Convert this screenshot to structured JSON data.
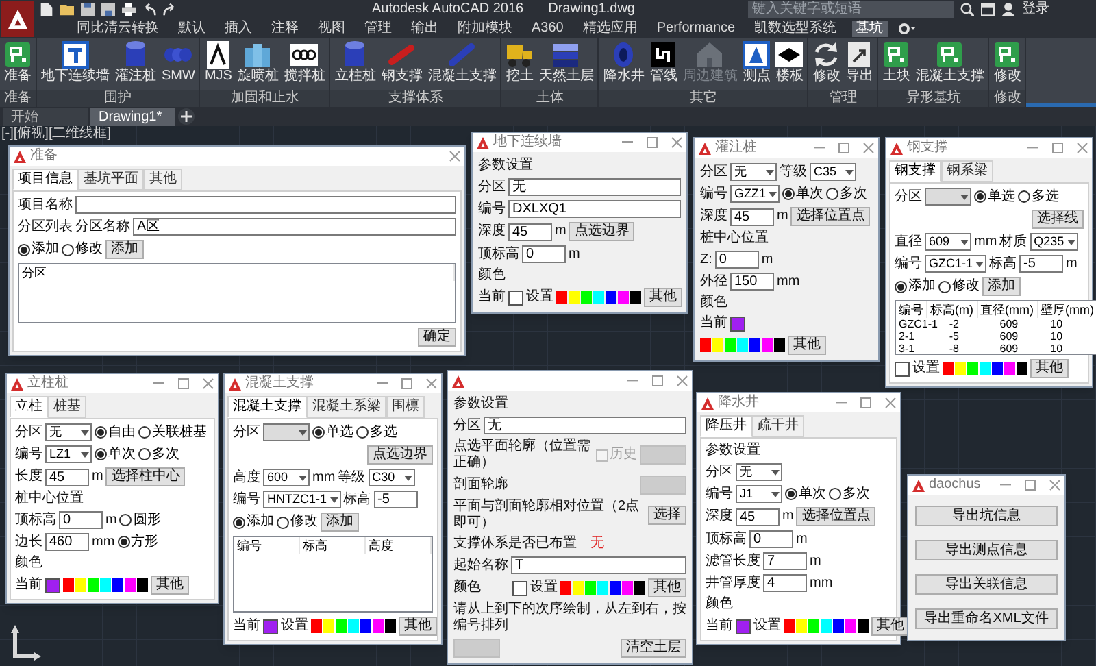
{
  "app": {
    "title": "Autodesk AutoCAD 2016",
    "document": "Drawing1.dwg",
    "search": {
      "placeholder": "键入关键字或短语"
    },
    "sign_in": "登录"
  },
  "menu_tabs": [
    {
      "label": "同比清云转换",
      "selected": false
    },
    {
      "label": "默认",
      "selected": false
    },
    {
      "label": "插入",
      "selected": false
    },
    {
      "label": "注释",
      "selected": false
    },
    {
      "label": "视图",
      "selected": false
    },
    {
      "label": "管理",
      "selected": false
    },
    {
      "label": "输出",
      "selected": false
    },
    {
      "label": "附加模块",
      "selected": false
    },
    {
      "label": "A360",
      "selected": false
    },
    {
      "label": "精选应用",
      "selected": false
    },
    {
      "label": "Performance",
      "selected": false
    },
    {
      "label": "凯数选型系统",
      "selected": false
    },
    {
      "label": "基坑",
      "selected": true
    }
  ],
  "ribbon": [
    {
      "label": "准备",
      "buttons": [
        {
          "label": "准备",
          "disabled": false
        }
      ]
    },
    {
      "label": "围护",
      "buttons": [
        {
          "label": "地下连续墙",
          "disabled": false
        },
        {
          "label": "灌注桩",
          "disabled": false
        },
        {
          "label": "SMW",
          "disabled": false
        }
      ]
    },
    {
      "label": "加固和止水",
      "buttons": [
        {
          "label": "MJS",
          "disabled": false
        },
        {
          "label": "旋喷桩",
          "disabled": false
        },
        {
          "label": "搅拌桩",
          "disabled": false
        }
      ]
    },
    {
      "label": "支撑体系",
      "buttons": [
        {
          "label": "立柱桩",
          "disabled": false
        },
        {
          "label": "钢支撑",
          "disabled": false
        },
        {
          "label": "混凝土支撑",
          "disabled": false
        }
      ]
    },
    {
      "label": "土体",
      "buttons": [
        {
          "label": "挖土",
          "disabled": false
        },
        {
          "label": "天然土层",
          "disabled": false
        }
      ]
    },
    {
      "label": "其它",
      "buttons": [
        {
          "label": "降水井",
          "disabled": false
        },
        {
          "label": "管线",
          "disabled": false
        },
        {
          "label": "周边建筑",
          "disabled": true
        },
        {
          "label": "测点",
          "disabled": false
        },
        {
          "label": "楼板",
          "disabled": false
        }
      ]
    },
    {
      "label": "管理",
      "buttons": [
        {
          "label": "修改",
          "disabled": false
        },
        {
          "label": "导出",
          "disabled": false
        }
      ]
    },
    {
      "label": "异形基坑",
      "buttons": [
        {
          "label": "土块",
          "disabled": false
        },
        {
          "label": "混凝土支撑",
          "disabled": false
        }
      ]
    },
    {
      "label": "修改",
      "buttons": [
        {
          "label": "修改",
          "disabled": false
        }
      ]
    }
  ],
  "doc_tabs": [
    {
      "label": "开始",
      "selected": false
    },
    {
      "label": "Drawing1*",
      "selected": true
    }
  ],
  "viewport_label": "[-][俯视][二维线框]",
  "windows": [
    {
      "title": "准备",
      "min_max": false,
      "tabs": [
        {
          "label": "项目信息",
          "selected": true
        },
        {
          "label": "基坑平面",
          "selected": false
        },
        {
          "label": "其他",
          "selected": false
        }
      ],
      "lines": [
        {
          "items": [
            {
              "kind": "label",
              "text": "项目名称"
            },
            {
              "kind": "field"
            }
          ]
        },
        {
          "items": [
            {
              "kind": "label",
              "text": "分区列表"
            },
            {
              "kind": "label",
              "text": "分区名称"
            },
            {
              "kind": "field",
              "value": "A区"
            }
          ]
        },
        {
          "items": [
            {
              "kind": "radio",
              "label": "添加",
              "selected": true
            },
            {
              "kind": "radio",
              "label": "修改",
              "selected": false
            },
            {
              "kind": "button",
              "label": "添加",
              "disabled": false
            }
          ]
        },
        {
          "items": [
            {
              "kind": "list",
              "columns": [
                "分区"
              ]
            }
          ]
        },
        {
          "items": [
            {
              "kind": "button",
              "label": "确定",
              "disabled": false
            }
          ]
        }
      ]
    },
    {
      "title": "地下连续墙",
      "min_max": true,
      "lines": [
        {
          "items": [
            {
              "kind": "label",
              "text": "参数设置"
            }
          ]
        },
        {
          "items": [
            {
              "kind": "label",
              "text": "分区"
            },
            {
              "kind": "field",
              "value": "无"
            }
          ]
        },
        {
          "items": [
            {
              "kind": "label",
              "text": "编号"
            },
            {
              "kind": "field",
              "value": "DXLXQ1"
            }
          ]
        },
        {
          "items": [
            {
              "kind": "label",
              "text": "深度"
            },
            {
              "kind": "input",
              "value": "45"
            },
            {
              "kind": "label",
              "text": "m"
            },
            {
              "kind": "button",
              "label": "点选边界",
              "disabled": false
            }
          ]
        },
        {
          "items": [
            {
              "kind": "label",
              "text": "顶标高"
            },
            {
              "kind": "input",
              "value": "0"
            },
            {
              "kind": "label",
              "text": "m"
            }
          ]
        },
        {
          "items": [
            {
              "kind": "label",
              "text": "颜色"
            }
          ]
        },
        {
          "items": [
            {
              "kind": "label",
              "text": "当前"
            },
            {
              "kind": "swatch",
              "color": "#ffffff"
            },
            {
              "kind": "label",
              "text": "设置"
            },
            {
              "kind": "palette",
              "swatches": [
                {
                  "color": "#ff0000"
                },
                {
                  "color": "#ffff00"
                },
                {
                  "color": "#00ff00"
                },
                {
                  "color": "#00ffff"
                },
                {
                  "color": "#0000ff"
                },
                {
                  "color": "#ff00ff"
                },
                {
                  "color": "#000000"
                }
              ]
            },
            {
              "kind": "button",
              "label": "其他",
              "disabled": false
            }
          ]
        }
      ]
    },
    {
      "title": "灌注桩",
      "min_max": true,
      "lines": [
        {
          "items": [
            {
              "kind": "label",
              "text": "分区"
            },
            {
              "kind": "combo",
              "value": "无",
              "disabled": false
            },
            {
              "kind": "label",
              "text": "等级"
            },
            {
              "kind": "combo",
              "value": "C35",
              "disabled": false
            }
          ]
        },
        {
          "items": [
            {
              "kind": "label",
              "text": "编号"
            },
            {
              "kind": "combo",
              "value": "GZZ1",
              "disabled": false
            },
            {
              "kind": "radio",
              "label": "单次",
              "selected": true
            },
            {
              "kind": "radio",
              "label": "多次",
              "selected": false
            }
          ]
        },
        {
          "items": [
            {
              "kind": "label",
              "text": "深度"
            },
            {
              "kind": "input",
              "value": "45"
            },
            {
              "kind": "label",
              "text": "m"
            },
            {
              "kind": "button",
              "label": "选择位置点",
              "disabled": false
            }
          ]
        },
        {
          "items": [
            {
              "kind": "label",
              "text": "桩中心位置"
            }
          ]
        },
        {
          "items": [
            {
              "kind": "label",
              "text": "Z:"
            },
            {
              "kind": "input",
              "value": "0"
            },
            {
              "kind": "label",
              "text": "m"
            }
          ]
        },
        {
          "items": [
            {
              "kind": "label",
              "text": "外径"
            },
            {
              "kind": "input",
              "value": "150"
            },
            {
              "kind": "label",
              "text": "mm"
            }
          ]
        },
        {
          "items": [
            {
              "kind": "label",
              "text": "颜色"
            }
          ]
        },
        {
          "items": [
            {
              "kind": "label",
              "text": "当前"
            },
            {
              "kind": "swatch",
              "color": "#a020f0"
            }
          ]
        },
        {
          "items": [
            {
              "kind": "palette",
              "swatches": [
                {
                  "color": "#ff0000"
                },
                {
                  "color": "#ffff00"
                },
                {
                  "color": "#00ff00"
                },
                {
                  "color": "#00ffff"
                },
                {
                  "color": "#0000ff"
                },
                {
                  "color": "#ff00ff"
                },
                {
                  "color": "#000000"
                }
              ]
            },
            {
              "kind": "button",
              "label": "其他",
              "disabled": false
            }
          ]
        }
      ]
    },
    {
      "title": "钢支撑",
      "min_max": true,
      "tabs": [
        {
          "label": "钢支撑",
          "selected": true
        },
        {
          "label": "钢系梁",
          "selected": false
        }
      ],
      "lines": [
        {
          "items": [
            {
              "kind": "label",
              "text": "分区"
            },
            {
              "kind": "combo",
              "disabled": true
            },
            {
              "kind": "radio",
              "label": "单选",
              "selected": true
            },
            {
              "kind": "radio",
              "label": "多选",
              "selected": false
            }
          ]
        },
        {
          "items": [
            {
              "kind": "button",
              "label": "选择线",
              "disabled": false
            }
          ]
        },
        {
          "items": [
            {
              "kind": "label",
              "text": "直径"
            },
            {
              "kind": "combo",
              "value": "609",
              "disabled": false
            },
            {
              "kind": "label",
              "text": "mm"
            },
            {
              "kind": "label",
              "text": "材质"
            },
            {
              "kind": "combo",
              "value": "Q235",
              "disabled": false
            }
          ]
        },
        {
          "items": [
            {
              "kind": "label",
              "text": "编号"
            },
            {
              "kind": "combo",
              "value": "GZC1-1",
              "disabled": false
            },
            {
              "kind": "label",
              "text": "标高"
            },
            {
              "kind": "input",
              "value": "-5"
            },
            {
              "kind": "label",
              "text": "m"
            }
          ]
        },
        {
          "items": [
            {
              "kind": "radio",
              "label": "添加",
              "selected": true
            },
            {
              "kind": "radio",
              "label": "修改",
              "selected": false
            },
            {
              "kind": "button",
              "label": "添加",
              "disabled": false
            }
          ]
        },
        {
          "items": [
            {
              "kind": "list",
              "columns": [
                "编号",
                "标高(m)",
                "直径(mm)",
                "壁厚(mm)"
              ],
              "rows": [
                [
                  "GZC1-1",
                  "-2",
                  "609",
                  "10"
                ],
                [
                  "2-1",
                  "-5",
                  "609",
                  "10"
                ],
                [
                  "3-1",
                  "-8",
                  "609",
                  "10"
                ]
              ]
            }
          ]
        },
        {
          "items": [
            {
              "kind": "swatch",
              "color": "#ffffff"
            },
            {
              "kind": "label",
              "text": "设置"
            },
            {
              "kind": "palette",
              "swatches": [
                {
                  "color": "#ff0000"
                },
                {
                  "color": "#ffff00"
                },
                {
                  "color": "#00ff00"
                },
                {
                  "color": "#00ffff"
                },
                {
                  "color": "#0000ff"
                },
                {
                  "color": "#ff00ff"
                },
                {
                  "color": "#000000"
                }
              ]
            },
            {
              "kind": "button",
              "label": "其他",
              "disabled": false
            }
          ]
        }
      ]
    },
    {
      "title": "立柱桩",
      "min_max": true,
      "tabs": [
        {
          "label": "立柱",
          "selected": true
        },
        {
          "label": "桩基",
          "selected": false
        }
      ],
      "lines": [
        {
          "items": [
            {
              "kind": "label",
              "text": "分区"
            },
            {
              "kind": "combo",
              "value": "无",
              "disabled": false
            },
            {
              "kind": "radio",
              "label": "自由",
              "selected": true
            },
            {
              "kind": "radio",
              "label": "关联桩基",
              "selected": false
            }
          ]
        },
        {
          "items": [
            {
              "kind": "label",
              "text": "编号"
            },
            {
              "kind": "combo",
              "value": "LZ1",
              "disabled": false
            },
            {
              "kind": "radio",
              "label": "单次",
              "selected": true
            },
            {
              "kind": "radio",
              "label": "多次",
              "selected": false
            }
          ]
        },
        {
          "items": [
            {
              "kind": "label",
              "text": "长度"
            },
            {
              "kind": "input",
              "value": "45"
            },
            {
              "kind": "label",
              "text": "m"
            },
            {
              "kind": "button",
              "label": "选择柱中心",
              "disabled": false
            }
          ]
        },
        {
          "items": [
            {
              "kind": "label",
              "text": "桩中心位置"
            }
          ]
        },
        {
          "items": [
            {
              "kind": "label",
              "text": "顶标高"
            },
            {
              "kind": "input",
              "value": "0"
            },
            {
              "kind": "label",
              "text": "m"
            },
            {
              "kind": "radio",
              "label": "圆形",
              "selected": false
            }
          ]
        },
        {
          "items": [
            {
              "kind": "label",
              "text": "边长"
            },
            {
              "kind": "input",
              "value": "460"
            },
            {
              "kind": "label",
              "text": "mm"
            },
            {
              "kind": "radio",
              "label": "方形",
              "selected": true
            }
          ]
        },
        {
          "items": [
            {
              "kind": "label",
              "text": "颜色"
            }
          ]
        },
        {
          "items": [
            {
              "kind": "label",
              "text": "当前"
            },
            {
              "kind": "swatch",
              "color": "#a020f0"
            },
            {
              "kind": "palette",
              "swatches": [
                {
                  "color": "#ff0000"
                },
                {
                  "color": "#ffff00"
                },
                {
                  "color": "#00ff00"
                },
                {
                  "color": "#00ffff"
                },
                {
                  "color": "#0000ff"
                },
                {
                  "color": "#ff00ff"
                },
                {
                  "color": "#000000"
                }
              ]
            },
            {
              "kind": "button",
              "label": "其他",
              "disabled": false
            }
          ]
        }
      ]
    },
    {
      "title": "混凝土支撑",
      "min_max": true,
      "tabs": [
        {
          "label": "混凝土支撑",
          "selected": true
        },
        {
          "label": "混凝土系梁",
          "selected": false
        },
        {
          "label": "围檩",
          "selected": false
        }
      ],
      "lines": [
        {
          "items": [
            {
              "kind": "label",
              "text": "分区"
            },
            {
              "kind": "combo",
              "disabled": true
            },
            {
              "kind": "radio",
              "label": "单选",
              "selected": true
            },
            {
              "kind": "radio",
              "label": "多选",
              "selected": false
            }
          ]
        },
        {
          "items": [
            {
              "kind": "button",
              "label": "点选边界",
              "disabled": false
            }
          ]
        },
        {
          "items": [
            {
              "kind": "label",
              "text": "高度"
            },
            {
              "kind": "combo",
              "value": "600",
              "disabled": false
            },
            {
              "kind": "label",
              "text": "mm"
            },
            {
              "kind": "label",
              "text": "等级"
            },
            {
              "kind": "combo",
              "value": "C30",
              "disabled": false
            }
          ]
        },
        {
          "items": [
            {
              "kind": "label",
              "text": "编号"
            },
            {
              "kind": "combo",
              "value": "HNTZC1-1",
              "disabled": false
            },
            {
              "kind": "label",
              "text": "标高"
            },
            {
              "kind": "input",
              "value": "-5"
            }
          ]
        },
        {
          "items": [
            {
              "kind": "radio",
              "label": "添加",
              "selected": true
            },
            {
              "kind": "radio",
              "label": "修改",
              "selected": false
            },
            {
              "kind": "button",
              "label": "添加",
              "disabled": false
            }
          ]
        },
        {
          "items": [
            {
              "kind": "list",
              "columns": [
                "编号",
                "标高",
                "高度"
              ]
            }
          ]
        },
        {
          "items": [
            {
              "kind": "label",
              "text": "当前"
            },
            {
              "kind": "swatch",
              "color": "#a020f0"
            },
            {
              "kind": "label",
              "text": "设置"
            },
            {
              "kind": "palette",
              "swatches": [
                {
                  "color": "#ff0000"
                },
                {
                  "color": "#ffff00"
                },
                {
                  "color": "#00ff00"
                },
                {
                  "color": "#00ffff"
                },
                {
                  "color": "#0000ff"
                },
                {
                  "color": "#ff00ff"
                },
                {
                  "color": "#000000"
                }
              ]
            },
            {
              "kind": "button",
              "label": "其他",
              "disabled": false
            }
          ]
        }
      ]
    },
    {
      "min_max": true,
      "lines": [
        {
          "items": [
            {
              "kind": "label",
              "text": "参数设置"
            }
          ]
        },
        {
          "items": [
            {
              "kind": "label",
              "text": "分区"
            },
            {
              "kind": "field",
              "value": "无"
            }
          ]
        },
        {
          "items": [
            {
              "kind": "label",
              "text": "点选平面轮廓（位置需正确）"
            },
            {
              "kind": "checkbox",
              "label": "历史",
              "checked": false,
              "disabled": true
            },
            {
              "kind": "button",
              "disabled": true
            }
          ]
        },
        {
          "items": [
            {
              "kind": "label",
              "text": "剖面轮廓"
            },
            {
              "kind": "button",
              "disabled": true
            }
          ]
        },
        {
          "items": [
            {
              "kind": "label",
              "text": "平面与剖面轮廓相对位置（2点即可）"
            },
            {
              "kind": "button",
              "label": "选择",
              "disabled": false
            }
          ]
        },
        {
          "items": [
            {
              "kind": "label",
              "text": "支撑体系是否已布置"
            },
            {
              "kind": "note",
              "text": "无"
            }
          ]
        },
        {
          "items": [
            {
              "kind": "label",
              "text": "起始名称"
            },
            {
              "kind": "field",
              "value": "T"
            }
          ]
        },
        {
          "items": [
            {
              "kind": "label",
              "text": "颜色"
            },
            {
              "kind": "swatch",
              "color": "#ffffff"
            },
            {
              "kind": "label",
              "text": "设置"
            },
            {
              "kind": "palette",
              "swatches": [
                {
                  "color": "#ff0000"
                },
                {
                  "color": "#ffff00"
                },
                {
                  "color": "#00ff00"
                },
                {
                  "color": "#00ffff"
                },
                {
                  "color": "#0000ff"
                },
                {
                  "color": "#ff00ff"
                },
                {
                  "color": "#000000"
                }
              ]
            },
            {
              "kind": "button",
              "label": "其他",
              "disabled": false
            }
          ]
        },
        {
          "items": [
            {
              "kind": "label",
              "text": "请从上到下的次序绘制，从左到右，按编号排列"
            }
          ]
        },
        {
          "items": [
            {
              "kind": "button",
              "disabled": true
            },
            {
              "kind": "button",
              "label": "清空土层",
              "disabled": false
            }
          ]
        }
      ]
    },
    {
      "title": "降水井",
      "min_max": true,
      "tabs": [
        {
          "label": "降压井",
          "selected": true
        },
        {
          "label": "疏干井",
          "selected": false
        }
      ],
      "lines": [
        {
          "items": [
            {
              "kind": "label",
              "text": "参数设置"
            }
          ]
        },
        {
          "items": [
            {
              "kind": "label",
              "text": "分区"
            },
            {
              "kind": "combo",
              "value": "无",
              "disabled": false
            }
          ]
        },
        {
          "items": [
            {
              "kind": "label",
              "text": "编号"
            },
            {
              "kind": "combo",
              "value": "J1",
              "disabled": false
            },
            {
              "kind": "radio",
              "label": "单次",
              "selected": true
            },
            {
              "kind": "radio",
              "label": "多次",
              "selected": false
            }
          ]
        },
        {
          "items": [
            {
              "kind": "label",
              "text": "深度"
            },
            {
              "kind": "input",
              "value": "45"
            },
            {
              "kind": "label",
              "text": "m"
            },
            {
              "kind": "button",
              "label": "选择位置点",
              "disabled": false
            }
          ]
        },
        {
          "items": [
            {
              "kind": "label",
              "text": "顶标高"
            },
            {
              "kind": "input",
              "value": "0"
            },
            {
              "kind": "label",
              "text": "m"
            }
          ]
        },
        {
          "items": [
            {
              "kind": "label",
              "text": "滤管长度"
            },
            {
              "kind": "input",
              "value": "7"
            },
            {
              "kind": "label",
              "text": "m"
            }
          ]
        },
        {
          "items": [
            {
              "kind": "label",
              "text": "井管厚度"
            },
            {
              "kind": "input",
              "value": "4"
            },
            {
              "kind": "label",
              "text": "mm"
            }
          ]
        },
        {
          "items": [
            {
              "kind": "label",
              "text": "颜色"
            }
          ]
        },
        {
          "items": [
            {
              "kind": "label",
              "text": "当前"
            },
            {
              "kind": "swatch",
              "color": "#a020f0"
            },
            {
              "kind": "label",
              "text": "设置"
            },
            {
              "kind": "palette",
              "swatches": [
                {
                  "color": "#ff0000"
                },
                {
                  "color": "#ffff00"
                },
                {
                  "color": "#00ff00"
                },
                {
                  "color": "#00ffff"
                },
                {
                  "color": "#0000ff"
                },
                {
                  "color": "#ff00ff"
                },
                {
                  "color": "#000000"
                }
              ]
            },
            {
              "kind": "button",
              "label": "其他",
              "disabled": false
            }
          ]
        }
      ]
    },
    {
      "title": "daochus",
      "min_max": true,
      "lines": [
        {
          "items": [
            {
              "kind": "button",
              "label": "导出坑信息",
              "disabled": false
            }
          ]
        },
        {
          "items": [
            {
              "kind": "button",
              "label": "导出测点信息",
              "disabled": false
            }
          ]
        },
        {
          "items": [
            {
              "kind": "button",
              "label": "导出关联信息",
              "disabled": false
            }
          ]
        },
        {
          "items": [
            {
              "kind": "button",
              "label": "导出重命名XML文件",
              "disabled": false
            }
          ]
        }
      ]
    }
  ]
}
